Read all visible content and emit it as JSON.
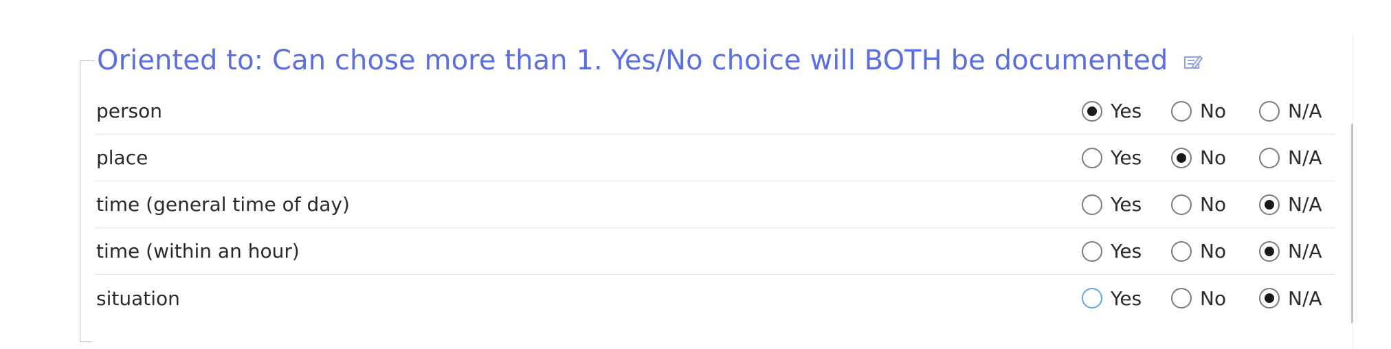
{
  "group": {
    "title": "Oriented to: Can chose more than 1. Yes/No choice will BOTH be documented",
    "edit_icon": "edit-note-icon",
    "accent_color": "#5b6fe0"
  },
  "option_labels": {
    "yes": "Yes",
    "no": "No",
    "na": "N/A"
  },
  "rows": [
    {
      "label": "person",
      "selected": "yes"
    },
    {
      "label": "place",
      "selected": "no"
    },
    {
      "label": "time (general time of day)",
      "selected": "na"
    },
    {
      "label": "time (within an hour)",
      "selected": "na"
    },
    {
      "label": "situation",
      "selected": "na",
      "focused": "yes"
    }
  ]
}
